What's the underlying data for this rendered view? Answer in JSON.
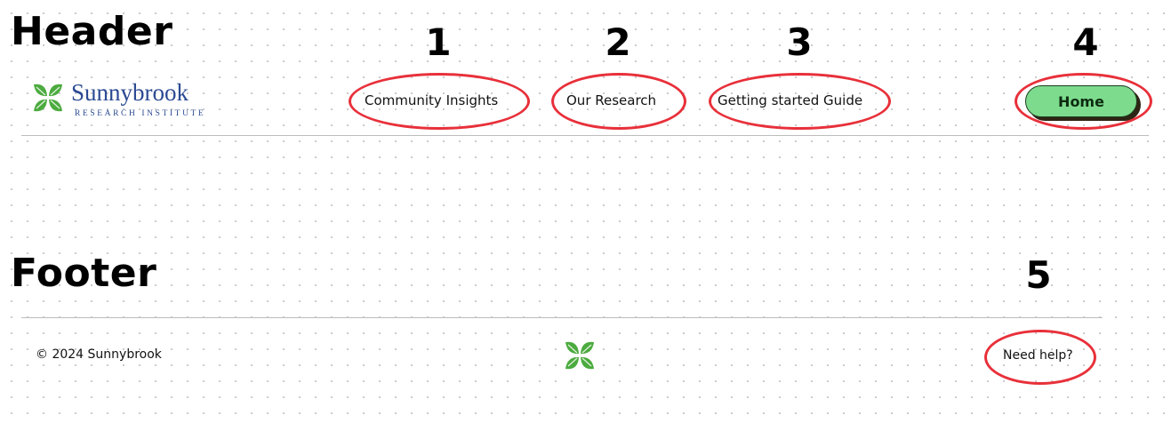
{
  "header": {
    "section_label": "Header",
    "logo": {
      "name": "Sunnybrook",
      "subtitle": "RESEARCH INSTITUTE",
      "icon": "leaf-cluster-icon"
    },
    "nav": [
      {
        "number": "1",
        "label": "Community Insights"
      },
      {
        "number": "2",
        "label": "Our Research"
      },
      {
        "number": "3",
        "label": "Getting started Guide"
      }
    ],
    "home_button": {
      "number": "4",
      "label": "Home"
    }
  },
  "footer": {
    "section_label": "Footer",
    "copyright": "© 2024 Sunnybrook",
    "icon": "leaf-cluster-icon",
    "help": {
      "number": "5",
      "label": "Need help?"
    }
  },
  "colors": {
    "annotation_red": "#e8303a",
    "brand_blue": "#2b4a93",
    "leaf_green": "#4cab3f",
    "button_green": "#7ddb8d",
    "button_shadow": "#2e2414"
  }
}
